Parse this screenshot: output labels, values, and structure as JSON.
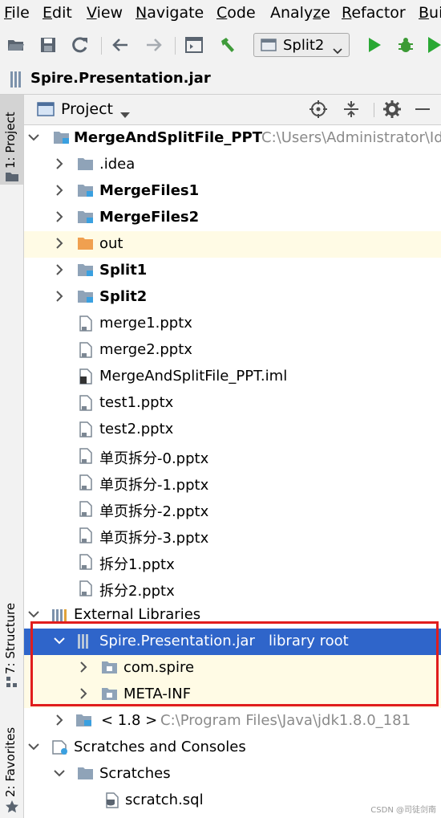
{
  "menu": [
    "File",
    "Edit",
    "View",
    "Navigate",
    "Code",
    "Analyze",
    "Refactor",
    "Bui"
  ],
  "toolbar": {
    "run_config": "Split2"
  },
  "breadcrumb": "Spire.Presentation.jar",
  "left_strip": {
    "project": "1: Project",
    "structure": "7: Structure",
    "favorites": "2: Favorites"
  },
  "panel": {
    "title": "Project"
  },
  "tree": {
    "root": {
      "name": "MergeAndSplitFile_PPT",
      "path": "C:\\Users\\Administrator\\Id"
    },
    "folders": [
      ".idea",
      "MergeFiles1",
      "MergeFiles2",
      "out",
      "Split1",
      "Split2"
    ],
    "files": [
      "merge1.pptx",
      "merge2.pptx",
      "MergeAndSplitFile_PPT.iml",
      "test1.pptx",
      "test2.pptx",
      "单页拆分-0.pptx",
      "单页拆分-1.pptx",
      "单页拆分-2.pptx",
      "单页拆分-3.pptx",
      "拆分1.pptx",
      "拆分2.pptx"
    ],
    "external_libraries": "External Libraries",
    "jar": {
      "name": "Spire.Presentation.jar",
      "suffix": "library root"
    },
    "packages": [
      "com.spire",
      "META-INF"
    ],
    "jdk": {
      "name": "< 1.8 >",
      "path": "C:\\Program Files\\Java\\jdk1.8.0_181"
    },
    "scratches_consoles": "Scratches and Consoles",
    "scratches": "Scratches",
    "scratch_file": "scratch.sql"
  },
  "watermark": "CSDN @司徒剑南",
  "colors": {
    "selection": "#2f65ca",
    "highlight": "#fffbe5",
    "callout": "#e01d1d",
    "folder": "#8fa3b8",
    "module_marker": "#3aa0e0",
    "out_folder": "#f0a050",
    "run": "#2aa834",
    "debug": "#3c9a35"
  }
}
